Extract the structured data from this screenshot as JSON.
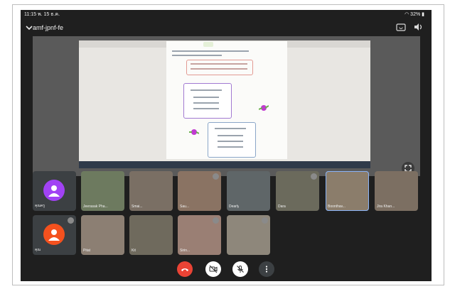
{
  "status_bar": {
    "time": "11:15 พ. 15 ธ.ค.",
    "battery": "32%"
  },
  "meeting": {
    "code": "amf-jpnf-fe"
  },
  "icons": {
    "collapse": "chevron-down-icon",
    "switch_camera": "camera-switch-icon",
    "audio": "speaker-icon",
    "fullscreen": "fullscreen-icon",
    "end_call": "end-call-icon",
    "camera": "camera-off-icon",
    "mic": "mic-off-icon",
    "more": "more-vertical-icon"
  },
  "colors": {
    "background": "#1f1f1f",
    "tile": "#3c4043",
    "end_call": "#ea4335",
    "control": "#ffffff",
    "active_speaker": "#8ab4f8",
    "avatar_purple": "#a142f4",
    "avatar_orange": "#f4511e"
  },
  "participants": [
    {
      "label": "คุณครู",
      "type": "avatar"
    },
    {
      "label": "Jeerasak Pha...",
      "type": "video"
    },
    {
      "label": "Smai...",
      "type": "video"
    },
    {
      "label": "Sau...",
      "type": "video"
    },
    {
      "label": "Dearly",
      "type": "video"
    },
    {
      "label": "Dara",
      "type": "video"
    },
    {
      "label": "Boonthav...",
      "type": "video",
      "active": true
    },
    {
      "label": "Jira Khan...",
      "type": "video"
    },
    {
      "label": "คุณ",
      "type": "avatar"
    },
    {
      "label": "Pitat",
      "type": "video"
    },
    {
      "label": "Kit",
      "type": "video"
    },
    {
      "label": "Sirin...",
      "type": "video"
    },
    {
      "label": "",
      "type": "video"
    }
  ]
}
